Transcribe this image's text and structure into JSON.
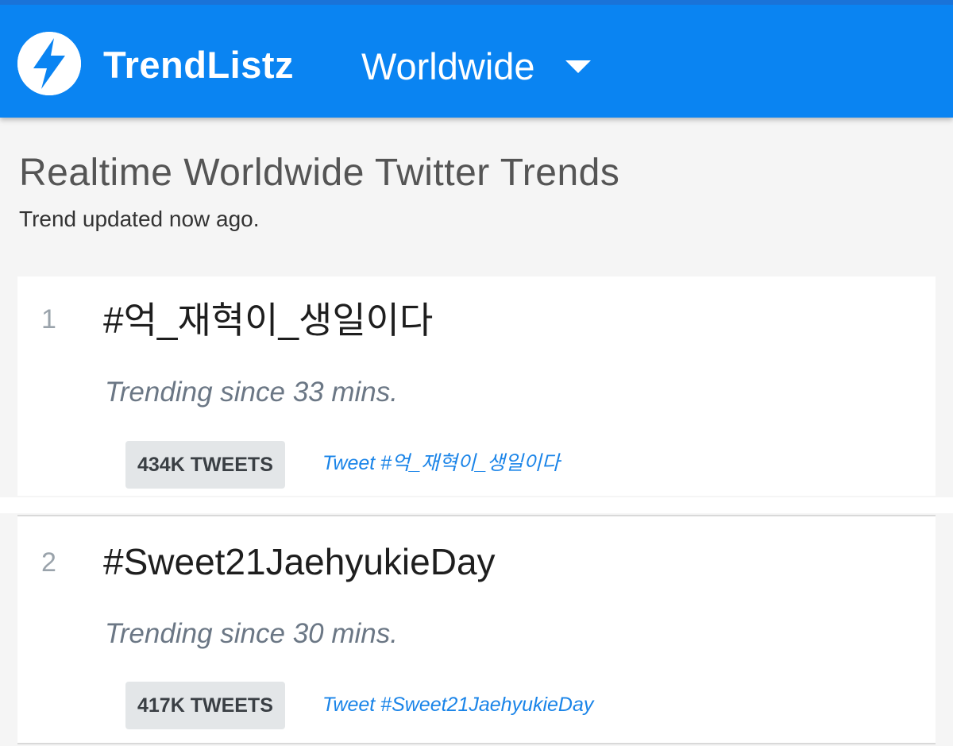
{
  "header": {
    "logo_icon": "lightning-bolt-icon",
    "brand": "TrendListz",
    "region": "Worldwide",
    "accent_color": "#0a84f2"
  },
  "page": {
    "title": "Realtime Worldwide Twitter Trends",
    "updated": "Trend updated now ago."
  },
  "trends": [
    {
      "rank": "1",
      "name": "#억_재혁이_생일이다",
      "since": "Trending since 33 mins.",
      "tweets": "434K TWEETS",
      "tweet_link": "Tweet #억_재혁이_생일이다"
    },
    {
      "rank": "2",
      "name": "#Sweet21JaehyukieDay",
      "since": "Trending since 30 mins.",
      "tweets": "417K TWEETS",
      "tweet_link": "Tweet #Sweet21JaehyukieDay"
    }
  ]
}
